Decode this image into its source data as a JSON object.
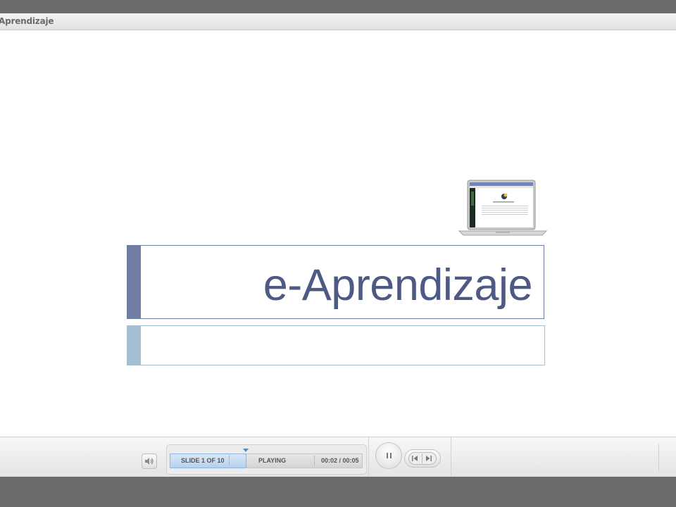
{
  "window": {
    "title": "Aprendizaje"
  },
  "slide": {
    "title": "e-Aprendizaje",
    "subtitle": "",
    "colors": {
      "title_accent": "#6f7da4",
      "title_text": "#4e5a83",
      "subtitle_accent": "#a4bed2"
    },
    "image": "laptop-screenshot"
  },
  "player": {
    "slide_counter": "SLIDE 1 OF 10",
    "status": "PLAYING",
    "time": "00:02 / 00:05",
    "progress_fraction": 0.1,
    "icons": {
      "volume": "volume-icon",
      "pause": "pause-icon",
      "previous": "previous-icon",
      "next": "next-icon"
    }
  }
}
